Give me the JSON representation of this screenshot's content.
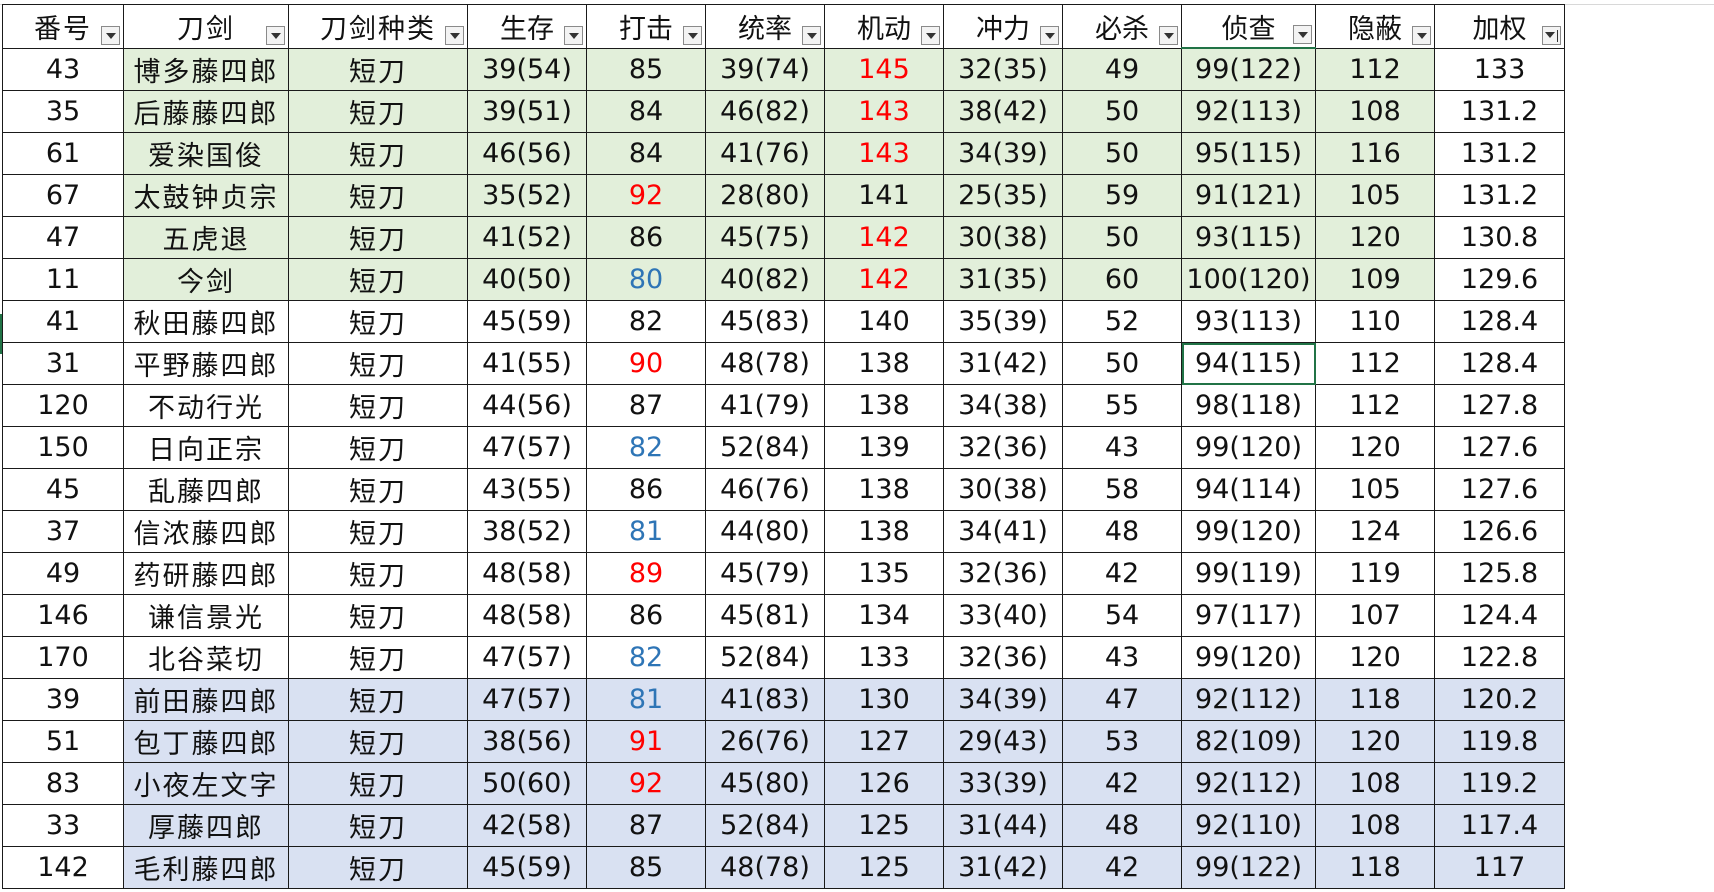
{
  "sheet": {
    "headers": [
      "番号",
      "刀剑",
      "刀剑种类",
      "生存",
      "打击",
      "统率",
      "机动",
      "冲力",
      "必杀",
      "侦查",
      "隐蔽",
      "加权"
    ],
    "rows": [
      {
        "band": "green",
        "cells": [
          "43",
          "博多藤四郎",
          "短刀",
          "39(54)",
          "85",
          "39(74)",
          "145",
          "32(35)",
          "49",
          "99(122)",
          "112",
          "133"
        ],
        "colors": {
          "6": "red"
        }
      },
      {
        "band": "green",
        "cells": [
          "35",
          "后藤藤四郎",
          "短刀",
          "39(51)",
          "84",
          "46(82)",
          "143",
          "38(42)",
          "50",
          "92(113)",
          "108",
          "131.2"
        ],
        "colors": {
          "6": "red"
        }
      },
      {
        "band": "green",
        "cells": [
          "61",
          "爱染国俊",
          "短刀",
          "46(56)",
          "84",
          "41(76)",
          "143",
          "34(39)",
          "50",
          "95(115)",
          "116",
          "131.2"
        ],
        "colors": {
          "6": "red"
        }
      },
      {
        "band": "green",
        "cells": [
          "67",
          "太鼓钟贞宗",
          "短刀",
          "35(52)",
          "92",
          "28(80)",
          "141",
          "25(35)",
          "59",
          "91(121)",
          "105",
          "131.2"
        ],
        "colors": {
          "4": "red"
        }
      },
      {
        "band": "green",
        "cells": [
          "47",
          "五虎退",
          "短刀",
          "41(52)",
          "86",
          "45(75)",
          "142",
          "30(38)",
          "50",
          "93(115)",
          "120",
          "130.8"
        ],
        "colors": {
          "6": "red"
        }
      },
      {
        "band": "green",
        "cells": [
          "11",
          "今剑",
          "短刀",
          "40(50)",
          "80",
          "40(82)",
          "142",
          "31(35)",
          "60",
          "100(120)",
          "109",
          "129.6"
        ],
        "colors": {
          "4": "blue",
          "6": "red"
        }
      },
      {
        "band": "none",
        "cells": [
          "41",
          "秋田藤四郎",
          "短刀",
          "45(59)",
          "82",
          "45(83)",
          "140",
          "35(39)",
          "52",
          "93(113)",
          "110",
          "128.4"
        ],
        "colors": {}
      },
      {
        "band": "none",
        "cells": [
          "31",
          "平野藤四郎",
          "短刀",
          "41(55)",
          "90",
          "48(78)",
          "138",
          "31(42)",
          "50",
          "94(115)",
          "112",
          "128.4"
        ],
        "colors": {
          "4": "red"
        }
      },
      {
        "band": "none",
        "cells": [
          "120",
          "不动行光",
          "短刀",
          "44(56)",
          "87",
          "41(79)",
          "138",
          "34(38)",
          "55",
          "98(118)",
          "112",
          "127.8"
        ],
        "colors": {}
      },
      {
        "band": "none",
        "cells": [
          "150",
          "日向正宗",
          "短刀",
          "47(57)",
          "82",
          "52(84)",
          "139",
          "32(36)",
          "43",
          "99(120)",
          "120",
          "127.6"
        ],
        "colors": {
          "4": "blue"
        }
      },
      {
        "band": "none",
        "cells": [
          "45",
          "乱藤四郎",
          "短刀",
          "43(55)",
          "86",
          "46(76)",
          "138",
          "30(38)",
          "58",
          "94(114)",
          "105",
          "127.6"
        ],
        "colors": {}
      },
      {
        "band": "none",
        "cells": [
          "37",
          "信浓藤四郎",
          "短刀",
          "38(52)",
          "81",
          "44(80)",
          "138",
          "34(41)",
          "48",
          "99(120)",
          "124",
          "126.6"
        ],
        "colors": {
          "4": "blue"
        }
      },
      {
        "band": "none",
        "cells": [
          "49",
          "药研藤四郎",
          "短刀",
          "48(58)",
          "89",
          "45(79)",
          "135",
          "32(36)",
          "42",
          "99(119)",
          "119",
          "125.8"
        ],
        "colors": {
          "4": "red"
        }
      },
      {
        "band": "none",
        "cells": [
          "146",
          "谦信景光",
          "短刀",
          "48(58)",
          "86",
          "45(81)",
          "134",
          "33(40)",
          "54",
          "97(117)",
          "107",
          "124.4"
        ],
        "colors": {}
      },
      {
        "band": "none",
        "cells": [
          "170",
          "北谷菜切",
          "短刀",
          "47(57)",
          "82",
          "52(84)",
          "133",
          "32(36)",
          "43",
          "99(120)",
          "120",
          "122.8"
        ],
        "colors": {
          "4": "blue"
        }
      },
      {
        "band": "blue",
        "cells": [
          "39",
          "前田藤四郎",
          "短刀",
          "47(57)",
          "81",
          "41(83)",
          "130",
          "34(39)",
          "47",
          "92(112)",
          "118",
          "120.2"
        ],
        "colors": {
          "4": "blue"
        }
      },
      {
        "band": "blue",
        "cells": [
          "51",
          "包丁藤四郎",
          "短刀",
          "38(56)",
          "91",
          "26(76)",
          "127",
          "29(43)",
          "53",
          "82(109)",
          "120",
          "119.8"
        ],
        "colors": {
          "4": "red"
        }
      },
      {
        "band": "blue",
        "cells": [
          "83",
          "小夜左文字",
          "短刀",
          "50(60)",
          "92",
          "45(80)",
          "126",
          "33(39)",
          "42",
          "92(112)",
          "108",
          "119.2"
        ],
        "colors": {
          "4": "red"
        }
      },
      {
        "band": "blue",
        "cells": [
          "33",
          "厚藤四郎",
          "短刀",
          "42(58)",
          "87",
          "52(84)",
          "125",
          "31(44)",
          "48",
          "92(110)",
          "108",
          "117.4"
        ],
        "colors": {}
      },
      {
        "band": "blue",
        "cells": [
          "142",
          "毛利藤四郎",
          "短刀",
          "45(59)",
          "85",
          "48(78)",
          "125",
          "31(42)",
          "42",
          "99(122)",
          "118",
          "117"
        ],
        "colors": {}
      }
    ]
  },
  "colors": {
    "green_band": "#e2efda",
    "blue_band": "#d9e1f2",
    "red_text": "#ff0000",
    "blue_text": "#2e75b6",
    "selection": "#217346"
  },
  "icons": {
    "filter": "filter-dropdown-icon",
    "sort": "sort-descending-filter-icon"
  }
}
